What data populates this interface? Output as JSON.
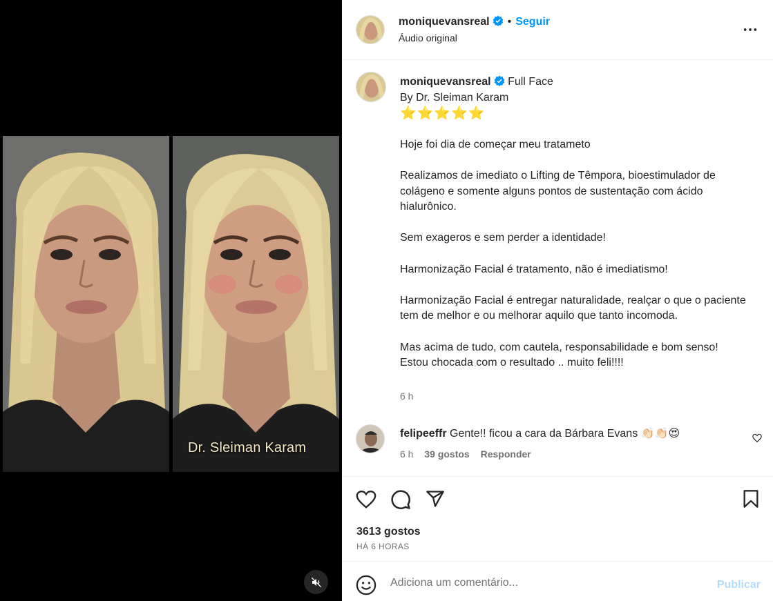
{
  "post": {
    "username": "moniquevansreal",
    "follow_label": "Seguir",
    "separator": "•",
    "audio_label": "Áudio original",
    "media": {
      "watermark": "Dr. Sleiman Karam"
    }
  },
  "caption": {
    "username": "moniquevansreal",
    "title": "Full Face",
    "byline": "By Dr. Sleiman Karam",
    "stars": "⭐⭐⭐⭐⭐",
    "paragraph_1": "Hoje foi dia de começar meu tratameto",
    "paragraph_2": "Realizamos de imediato o Lifting de Têmpora, bioestimulador de colágeno e somente alguns pontos de sustentação com ácido hialurônico.",
    "paragraph_3": "Sem exageros e sem perder a identidade!",
    "paragraph_4": "Harmonização Facial é tratamento, não é imediatismo!",
    "paragraph_5": "Harmonização Facial é entregar naturalidade, realçar o que o paciente tem de melhor e ou melhorar aquilo que tanto incomoda.",
    "paragraph_6a": "Mas acima de tudo, com cautela, responsabilidade e bom senso!",
    "paragraph_6b": "Estou chocada com o resultado .. muito feli!!!!",
    "time": "6 h"
  },
  "comment": {
    "username": "felipeeffr",
    "text": "Gente!! ficou a cara da Bárbara Evans 👏🏻👏🏻😍",
    "time": "6 h",
    "likes": "39 gostos",
    "reply_label": "Responder"
  },
  "actions": {
    "likes_count": "3613 gostos",
    "posted_ago": "HÁ 6 HORAS",
    "icons": [
      "heart-icon",
      "comment-icon",
      "share-icon",
      "bookmark-icon"
    ]
  },
  "composer": {
    "placeholder": "Adiciona um comentário...",
    "publish_label": "Publicar"
  },
  "colors": {
    "accent": "#0095f6",
    "publish_disabled": "#b3dbff",
    "secondary_text": "#737373",
    "verified": "#0095f6"
  }
}
